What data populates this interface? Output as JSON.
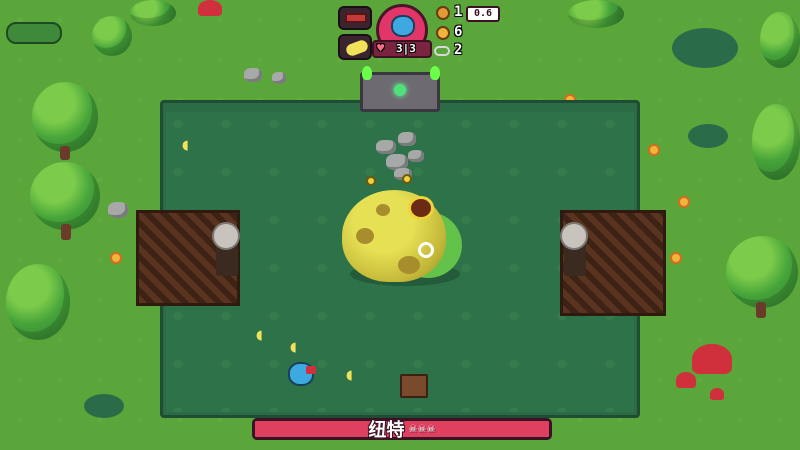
{
  "hud": {
    "health": "3|3",
    "coins_top": "1",
    "xp": "0.6",
    "coins_mid": "6",
    "keys": "2",
    "player_icon": "bird-portrait-icon",
    "weapon_icon": "crossbow-icon",
    "item_icon": "banana-bunch-icon",
    "heart_icon": "heart-icon"
  },
  "boss": {
    "name": "纽特",
    "skulls": "☠☠☠",
    "health_fraction": 1.0,
    "icon": "frog-boss-icon"
  },
  "colors": {
    "grass": "#5aa63a",
    "arena": "#2e7249",
    "boss_bar": "#e0405f",
    "portrait": "#e2356a"
  }
}
